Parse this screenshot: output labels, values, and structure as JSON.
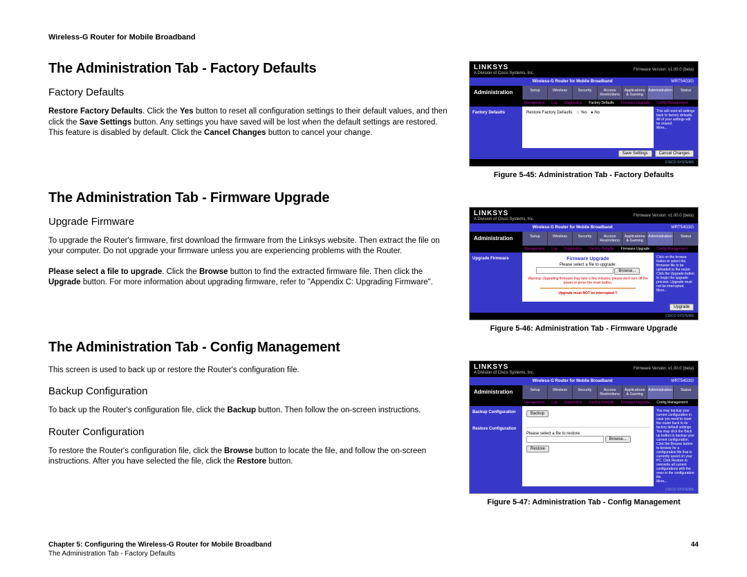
{
  "doc_header": "Wireless-G Router for Mobile Broadband",
  "sections": {
    "factory": {
      "title": "The Administration Tab - Factory Defaults",
      "subtitle": "Factory Defaults",
      "para1_prefix": "Restore Factory Defaults",
      "para1_mid1": ". Click the ",
      "para1_bold1": "Yes",
      "para1_mid2": " button to reset all configuration settings to their default values, and then click the ",
      "para1_bold2": "Save Settings",
      "para1_mid3": " button. Any settings you have saved will be lost when the default settings are restored. This feature is disabled by default. Click the ",
      "para1_bold3": "Cancel Changes",
      "para1_end": " button to cancel your change."
    },
    "firmware": {
      "title": "The Administration Tab - Firmware Upgrade",
      "subtitle": "Upgrade Firmware",
      "para1": "To upgrade the Router's firmware, first download the firmware from the Linksys website. Then extract the file on your computer. Do not upgrade your firmware unless you are experiencing problems with the Router.",
      "para2_bold1": "Please select a file to upgrade",
      "para2_mid1": ". Click the ",
      "para2_bold2": "Browse",
      "para2_mid2": " button to find the extracted firmware file. Then click the ",
      "para2_bold3": "Upgrade",
      "para2_end": " button. For more information about upgrading firmware, refer to \"Appendix C: Upgrading Firmware\"."
    },
    "config": {
      "title": "The Administration Tab - Config Management",
      "para1": "This screen is used to back up or restore the Router's configuration file.",
      "sub1": "Backup Configuration",
      "para2_pre": "To back up the Router's configuration file, click the ",
      "para2_bold": "Backup",
      "para2_end": " button. Then follow the on-screen instructions.",
      "sub2": "Router Configuration",
      "para3_pre": "To restore the Router's configuration file, click the ",
      "para3_bold1": "Browse",
      "para3_mid": " button to locate the file, and follow the on-screen instructions. After you have selected the file, click the ",
      "para3_bold2": "Restore",
      "para3_end": " button."
    }
  },
  "figures": {
    "f45": {
      "caption": "Figure 5-45: Administration Tab - Factory Defaults"
    },
    "f46": {
      "caption": "Figure 5-46: Administration Tab - Firmware Upgrade"
    },
    "f47": {
      "caption": "Figure 5-47: Administration Tab - Config Management"
    }
  },
  "router": {
    "logo": "LINKSYS",
    "tagline": "A Division of Cisco Systems, Inc.",
    "fwver": "Firmware Version: v1.00.0 (beta)",
    "product": "Wireless-G Router for Mobile Broadband",
    "model": "WRT54G3G",
    "admin_label": "Administration",
    "tabs": [
      "Setup",
      "Wireless",
      "Security",
      "Access Restrictions",
      "Applications & Gaming",
      "Administration",
      "Status"
    ],
    "subtabs": [
      "Management",
      "Log",
      "Diagnostics",
      "Factory Defaults",
      "Firmware Upgrade",
      "Config Management"
    ],
    "factory": {
      "side": "Factory Defaults",
      "line": "Restore Factory Defaults:",
      "opt_yes": "Yes",
      "opt_no": "No",
      "help": "This will reset all settings back to factory defaults. All of your settings will be erased.",
      "more": "More..."
    },
    "firmware": {
      "side": "Upgrade Firmware",
      "title": "Firmware Upgrade",
      "select": "Please select a file to upgrade:",
      "warn": "Warning: Upgrading firmware may take a few minutes, please don't turn off the power or press the reset button.",
      "nointerrupt": "Upgrade must NOT be interrupted !!",
      "help": "Click on the browse button to select the firmware file to be uploaded to the router.\nClick the Upgrade button to begin the upgrade process. Upgrade must not be interrupted.",
      "more": "More..."
    },
    "config": {
      "side1": "Backup Configuration",
      "side2": "Restore Configuration",
      "restore_line": "Please select a file to restore:",
      "help": "You may backup your current configuration in case you need to reset the router back to its factory default settings.\nYou may click the Back up button to backup your current configuration.\nClick the Browse button to browse for a configuration file that is currently saved on your PC.\nClick Restore to overwrite all current configurations with the ones in the configuration file.",
      "more": "More..."
    },
    "btn_save": "Save Settings",
    "btn_cancel": "Cancel Changes",
    "btn_browse": "Browse...",
    "btn_upgrade": "Upgrade",
    "btn_backup": "Backup",
    "btn_restore": "Restore",
    "cisco": "CISCO SYSTEMS"
  },
  "footer": {
    "chapter": "Chapter 5: Configuring the Wireless-G Router for Mobile Broadband",
    "page": "44",
    "subline": "The Administration Tab - Factory Defaults"
  }
}
